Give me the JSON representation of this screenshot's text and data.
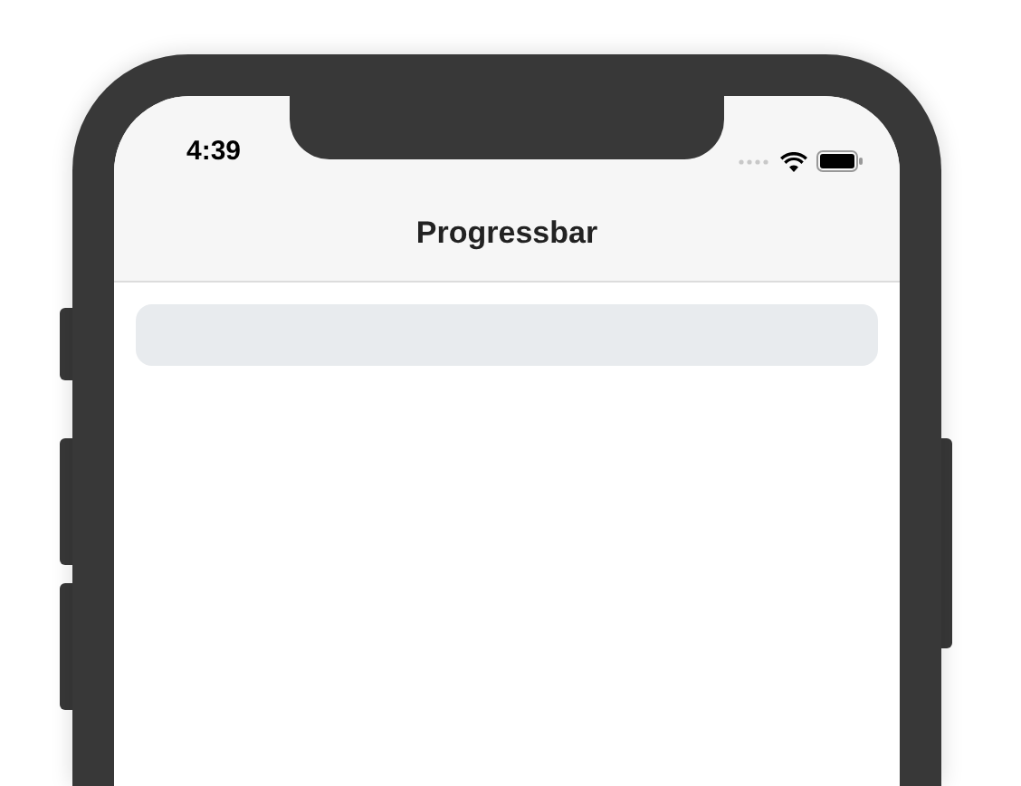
{
  "status_bar": {
    "time": "4:39"
  },
  "nav_bar": {
    "title": "Progressbar"
  },
  "progress_bar": {
    "level": 0
  }
}
